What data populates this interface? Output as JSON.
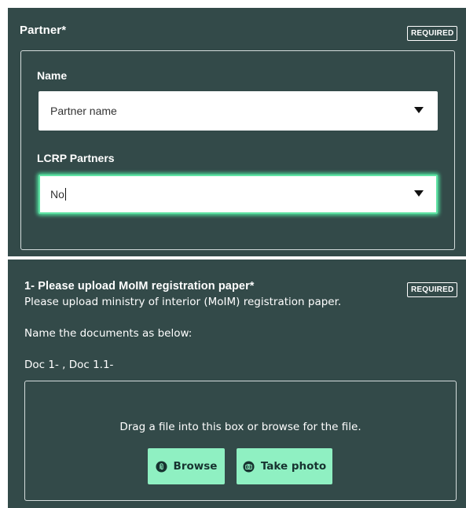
{
  "partner_section": {
    "title": "Partner*",
    "required_badge": "REQUIRED",
    "name_field": {
      "label": "Name",
      "value": "Partner name"
    },
    "lcrp_field": {
      "label": "LCRP Partners",
      "value": "No"
    }
  },
  "upload_section": {
    "title": "1- Please upload MoIM registration paper*",
    "required_badge": "REQUIRED",
    "description": "Please upload ministry of interior (MoIM) registration paper.",
    "instruction": "Name the documents as below:",
    "doc_names": "Doc 1- , Doc 1.1-",
    "drop_zone_text": "Drag a file into this box or browse for the file.",
    "browse_button": "Browse",
    "take_photo_button": "Take photo"
  },
  "colors": {
    "panel_bg": "#334a49",
    "button_bg": "#8ff0c2",
    "focus_border": "#5fe3a4"
  },
  "icons": {
    "browse": "paperclip-icon",
    "take_photo": "camera-icon",
    "dropdown": "dropdown-arrow-icon"
  }
}
